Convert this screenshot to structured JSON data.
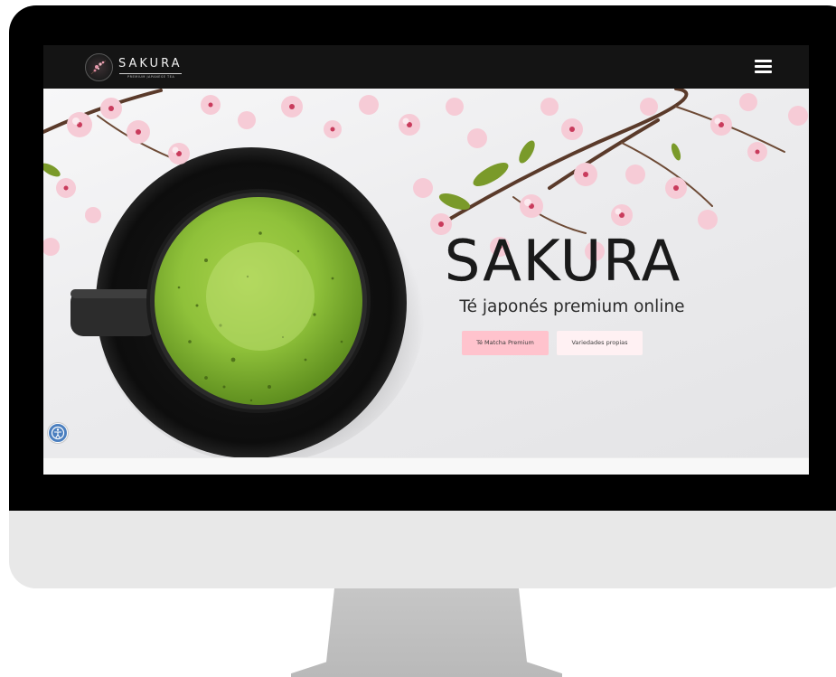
{
  "header": {
    "logo_text": "SAKURA",
    "logo_subtitle": "PREMIUM JAPANESE TEA",
    "logo_icon": "cherry-blossom-logo-icon",
    "menu_icon": "hamburger-menu-icon"
  },
  "hero": {
    "title": "SAKURA",
    "subtitle": "Té japonés premium online",
    "buttons": [
      {
        "label": "Té Matcha Premium"
      },
      {
        "label": "Variedades propias"
      }
    ],
    "image": "matcha-cup-with-cherry-blossoms"
  },
  "accessibility": {
    "icon": "accessibility-icon"
  },
  "colors": {
    "navbar": "#141414",
    "primary_button": "#ffc3cd",
    "secondary_button": "#fff1f3",
    "matcha": "#8fc13a",
    "blossom": "#f4c4cf"
  }
}
